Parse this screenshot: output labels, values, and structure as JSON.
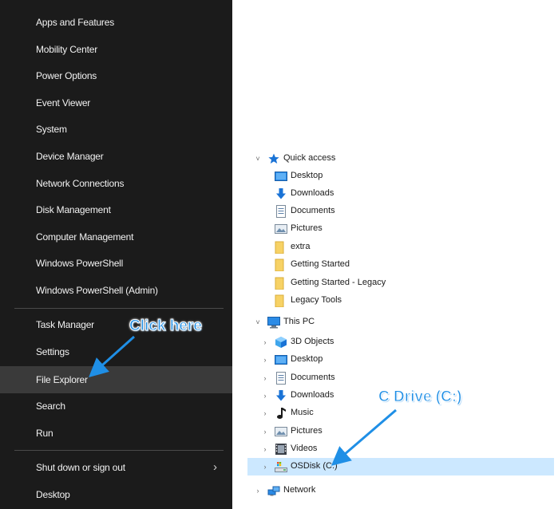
{
  "winx_menu": {
    "group1": [
      "Apps and Features",
      "Mobility Center",
      "Power Options",
      "Event Viewer",
      "System",
      "Device Manager",
      "Network Connections",
      "Disk Management",
      "Computer Management",
      "Windows PowerShell",
      "Windows PowerShell (Admin)"
    ],
    "group2": [
      "Task Manager",
      "Settings",
      "File Explorer",
      "Search",
      "Run"
    ],
    "group3": [
      "Shut down or sign out",
      "Desktop"
    ],
    "submenu_chevron": "›",
    "selected_item": "File Explorer"
  },
  "nav_tree": {
    "quick_access": {
      "label": "Quick access",
      "expander": "˅",
      "items": [
        "Desktop",
        "Downloads",
        "Documents",
        "Pictures",
        "extra",
        "Getting Started",
        "Getting Started - Legacy",
        "Legacy Tools"
      ]
    },
    "this_pc": {
      "label": "This PC",
      "expander": "˅",
      "items": [
        "3D Objects",
        "Desktop",
        "Documents",
        "Downloads",
        "Music",
        "Pictures",
        "Videos",
        "OSDisk (C:)"
      ],
      "child_expander": "›"
    },
    "network": {
      "label": "Network",
      "expander": "›"
    }
  },
  "annotations": {
    "click_here": "Click here",
    "c_drive": "C Drive (C:)",
    "color": "#1f8fe6"
  },
  "colors": {
    "menu_bg": "#1b1b1b",
    "menu_selected": "#3a3a3a",
    "tree_selected": "#cce8ff",
    "folder_yellow": "#f7d265",
    "accent_blue": "#1a73d6"
  }
}
